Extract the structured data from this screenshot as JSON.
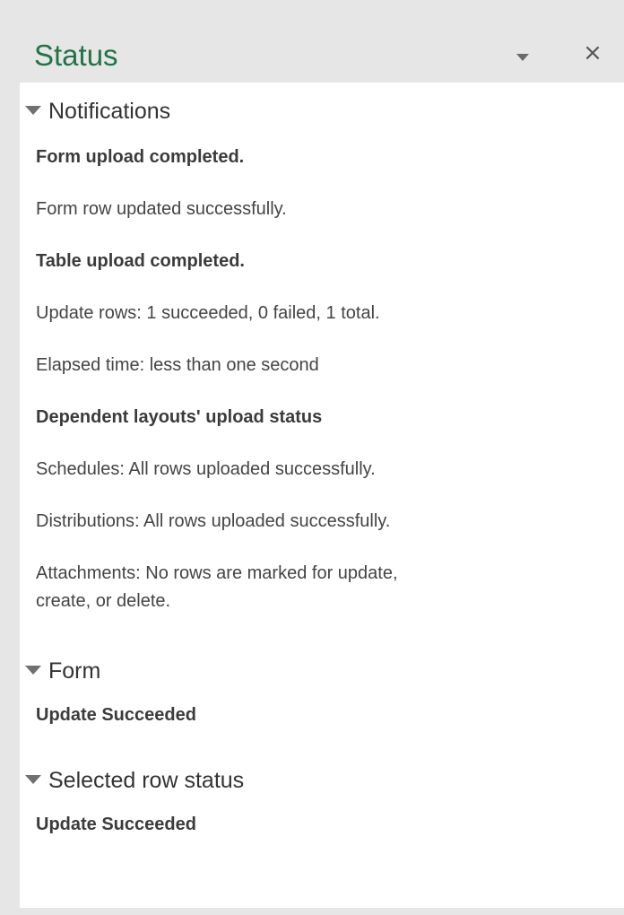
{
  "pane": {
    "title": "Status",
    "menu_icon": "dropdown-triangle-icon",
    "close_label": "×"
  },
  "sections": {
    "notifications": {
      "label": "Notifications",
      "messages": [
        "Form upload completed.",
        "Form row updated successfully.",
        "Table upload completed.",
        "Update rows:  1 succeeded, 0 failed, 1 total.",
        "Elapsed time: less than one second",
        "Dependent layouts' upload status",
        "Schedules: All rows uploaded successfully.",
        "Distributions: All rows uploaded successfully.",
        "Attachments: No rows are marked for update, create, or delete."
      ]
    },
    "form": {
      "label": "Form",
      "messages": [
        "Update Succeeded"
      ]
    },
    "selected_row": {
      "label": "Selected row status",
      "messages": [
        "Update Succeeded"
      ]
    }
  },
  "colors": {
    "title_green": "#217346",
    "background": "#e6e6e6",
    "content": "#ffffff"
  }
}
